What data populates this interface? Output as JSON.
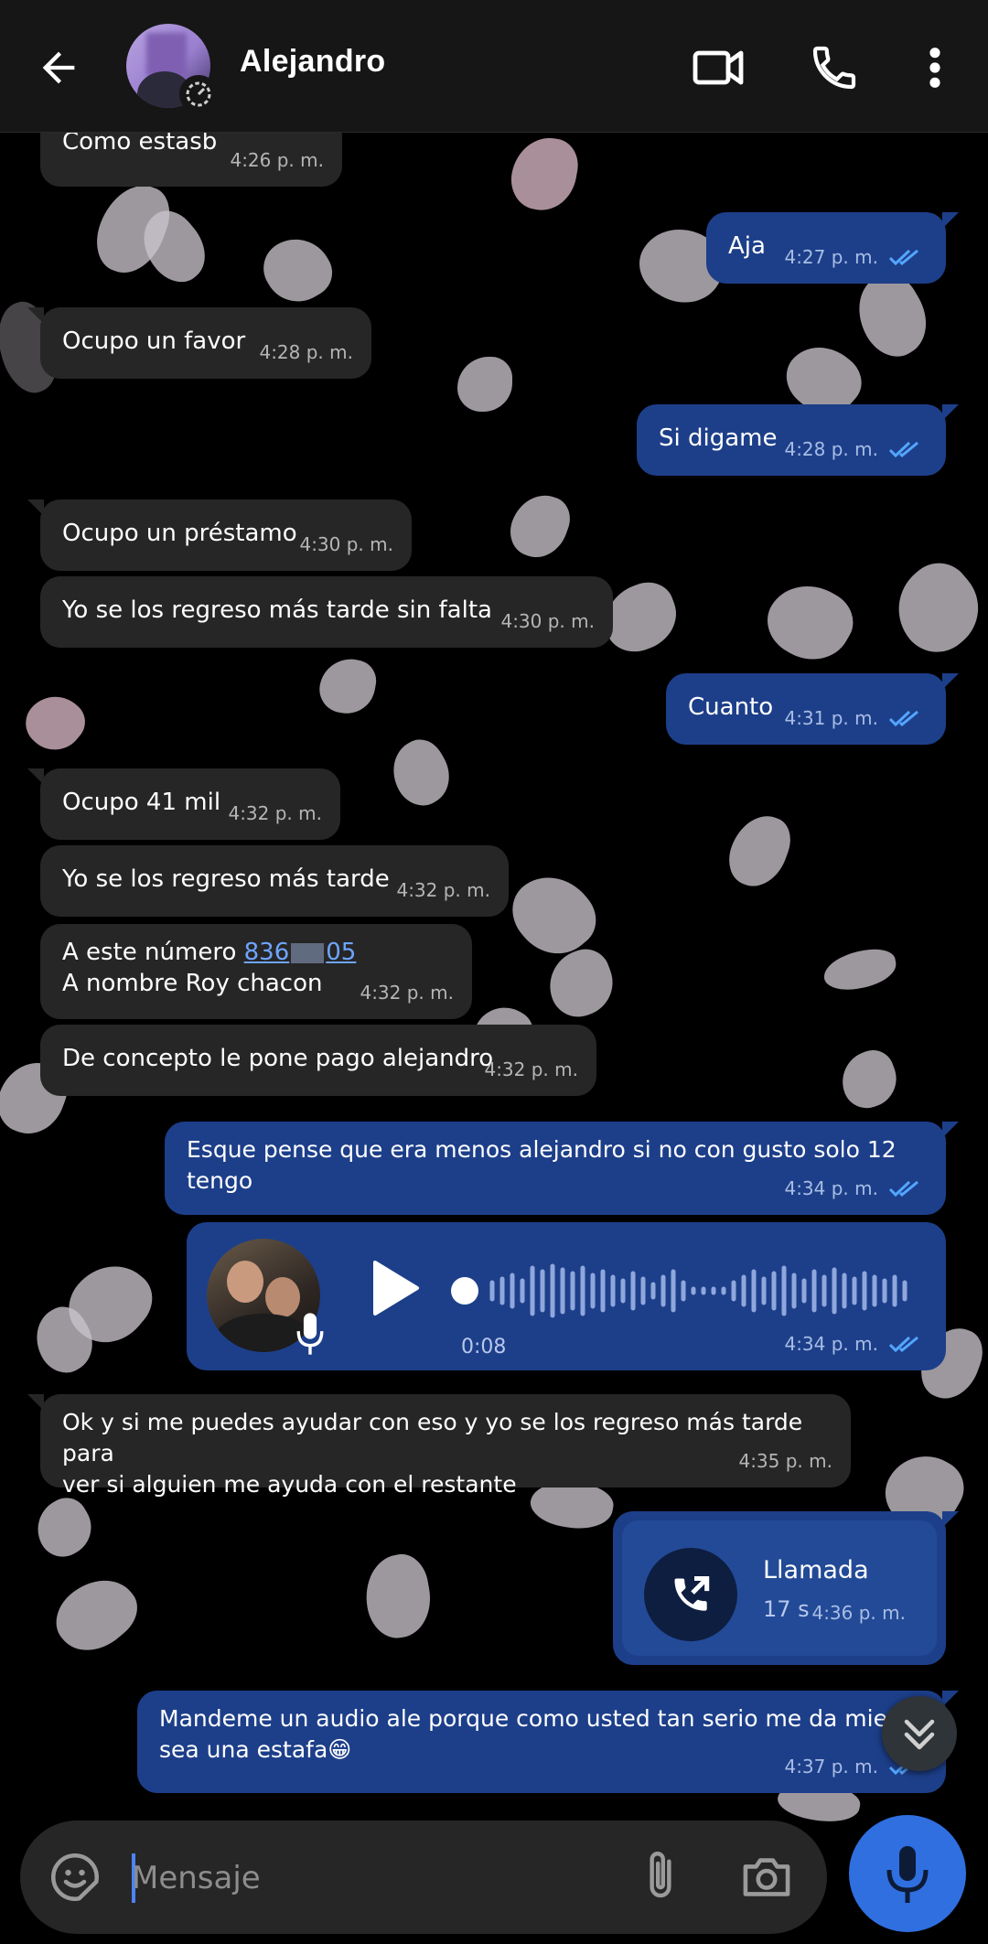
{
  "header": {
    "contact_name": "Alejandro"
  },
  "messages": [
    {
      "dir": "in",
      "text": "Como estasb",
      "time": "4:26 p. m."
    },
    {
      "dir": "out",
      "text": "Aja",
      "time": "4:27 p. m."
    },
    {
      "dir": "in",
      "text": "Ocupo un favor",
      "time": "4:28 p. m."
    },
    {
      "dir": "out",
      "text": "Si digame",
      "time": "4:28 p. m."
    },
    {
      "dir": "in",
      "text": "Ocupo un préstamo",
      "time": "4:30 p. m."
    },
    {
      "dir": "in",
      "text": "Yo se los regreso más tarde sin falta",
      "time": "4:30 p. m."
    },
    {
      "dir": "out",
      "text": "Cuanto",
      "time": "4:31 p. m."
    },
    {
      "dir": "in",
      "text": "Ocupo 41 mil",
      "time": "4:32 p. m."
    },
    {
      "dir": "in",
      "text": "Yo se los regreso más tarde",
      "time": "4:32 p. m."
    },
    {
      "dir": "in",
      "text_prefix": "A este número ",
      "link_start": "836",
      "link_end": "05",
      "line2": "A nombre Roy chacon",
      "time": "4:32 p. m."
    },
    {
      "dir": "in",
      "text": "De concepto le pone pago alejandro",
      "time": "4:32 p. m."
    },
    {
      "dir": "out",
      "text": "Esque pense que era menos alejandro si no con gusto solo 12 tengo",
      "time": "4:34 p. m."
    },
    {
      "dir": "out",
      "type": "audio",
      "duration": "0:08",
      "time": "4:34 p. m."
    },
    {
      "dir": "in",
      "line1": "Ok y si me puedes ayudar con eso y yo se los regreso más tarde para",
      "line2": "ver si alguien me ayuda con el restante",
      "time": "4:35 p. m."
    },
    {
      "dir": "out",
      "type": "call",
      "title": "Llamada",
      "duration": "17 s",
      "time": "4:36 p. m."
    },
    {
      "dir": "out",
      "line1": "Mandeme un audio ale porque como usted tan serio me da miedo q",
      "line2": "sea una estafa😁",
      "time": "4:37 p. m."
    }
  ],
  "composer": {
    "placeholder": "Mensaje"
  },
  "colors": {
    "incoming_bubble": "#262626",
    "outgoing_bubble": "#1d3f8a",
    "read_ticks": "#53a6ff",
    "link": "#6ea5ff",
    "mic_button": "#2f6fe0"
  },
  "icons": [
    "back-arrow-icon",
    "video-call-icon",
    "phone-icon",
    "more-vert-icon",
    "status-timer-icon",
    "double-check-icon",
    "play-icon",
    "mic-icon",
    "call-made-icon",
    "chevron-double-down-icon",
    "sticker-emoji-icon",
    "paperclip-icon",
    "camera-icon"
  ]
}
